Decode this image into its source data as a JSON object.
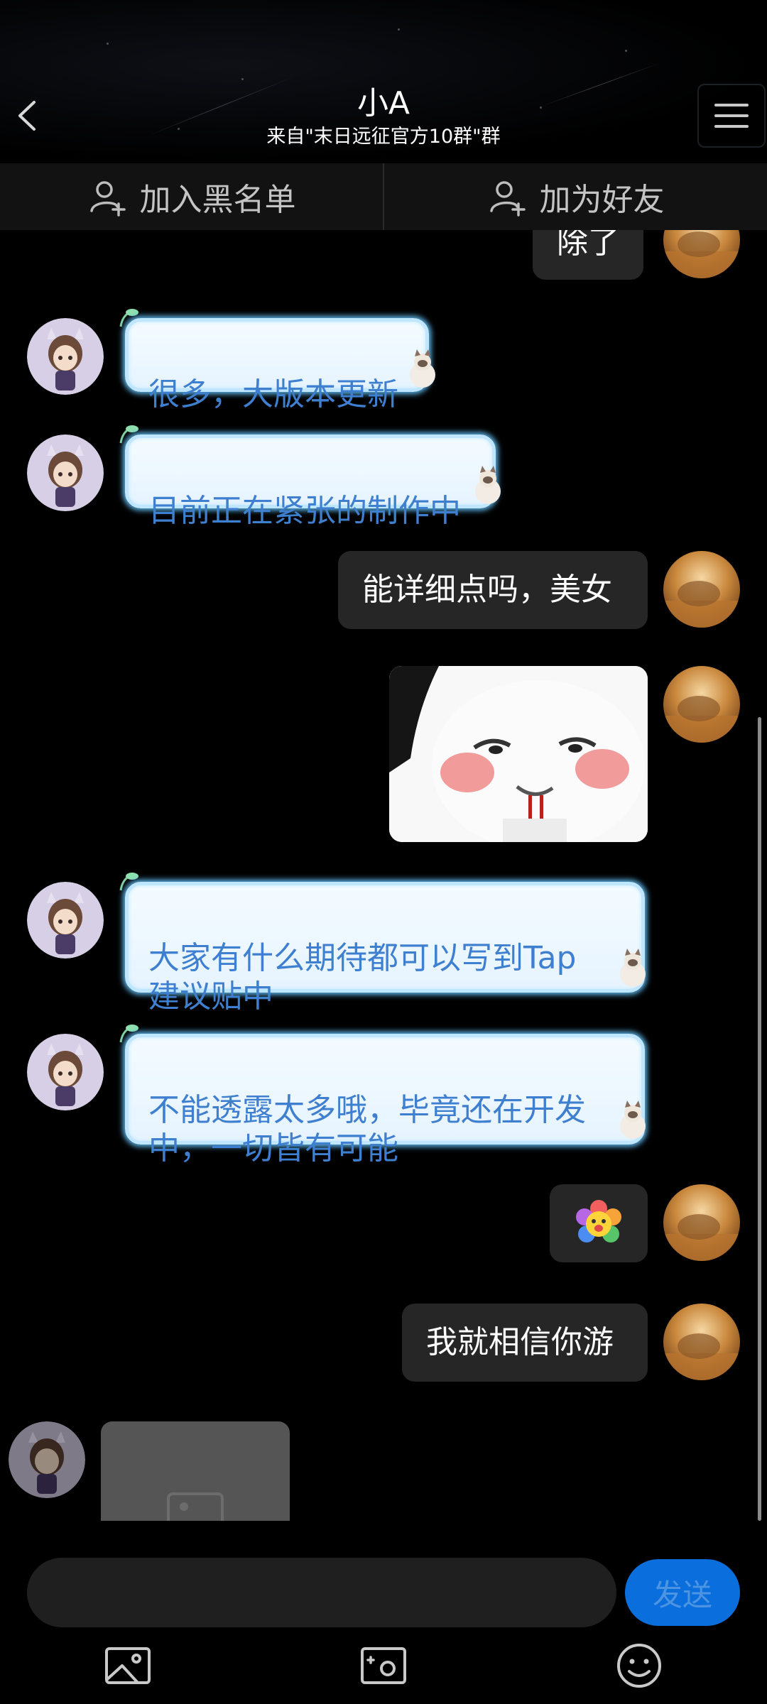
{
  "header": {
    "title": "小A",
    "subtitle": "来自\"末日远征官方10群\"群"
  },
  "actions": {
    "blacklist_label": "加入黑名单",
    "add_friend_label": "加为好友"
  },
  "messages": [
    {
      "side": "right",
      "type": "text",
      "text": "除了"
    },
    {
      "side": "left",
      "type": "text",
      "text": "很多，大版本更新"
    },
    {
      "side": "left",
      "type": "text",
      "text": "目前正在紧张的制作中"
    },
    {
      "side": "right",
      "type": "text",
      "text": "能详细点吗，美女"
    },
    {
      "side": "right",
      "type": "image",
      "icon": "meme-sticker"
    },
    {
      "side": "left",
      "type": "text",
      "text": "大家有什么期待都可以写到Tap\n建议贴中"
    },
    {
      "side": "left",
      "type": "text",
      "text": "不能透露太多哦，毕竟还在开发\n中，一切皆有可能"
    },
    {
      "side": "right",
      "type": "emoji",
      "icon": "rainbow-flower-emoji"
    },
    {
      "side": "right",
      "type": "text",
      "text": "我就相信你游"
    },
    {
      "side": "left",
      "type": "image",
      "icon": "image-placeholder-icon"
    }
  ],
  "input": {
    "send_label": "发送"
  },
  "toolbar": {
    "icons": [
      "image-icon",
      "camera-icon",
      "emoji-icon"
    ]
  },
  "colors": {
    "background": "#000000",
    "dark_bubble": "#262626",
    "light_bubble_text": "#3f7fd0",
    "send_button": "#0a6fdc"
  }
}
